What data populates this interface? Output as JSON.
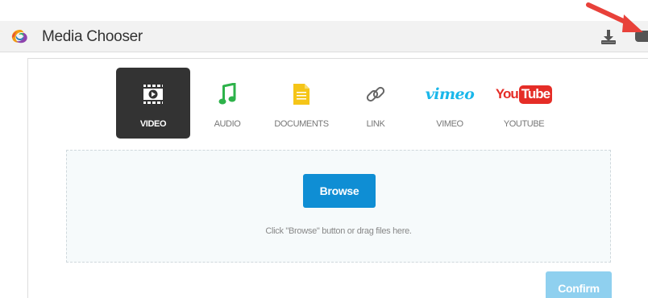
{
  "header": {
    "title": "Media Chooser"
  },
  "tabs": [
    {
      "id": "video",
      "label": "VIDEO",
      "icon": "film-icon",
      "active": true
    },
    {
      "id": "audio",
      "label": "AUDIO",
      "icon": "music-note-icon",
      "active": false
    },
    {
      "id": "documents",
      "label": "DOCUMENTS",
      "icon": "document-icon",
      "active": false
    },
    {
      "id": "link",
      "label": "LINK",
      "icon": "link-icon",
      "active": false
    },
    {
      "id": "vimeo",
      "label": "VIMEO",
      "icon": "vimeo-logo",
      "active": false,
      "logo_text": "vimeo"
    },
    {
      "id": "youtube",
      "label": "YOUTUBE",
      "icon": "youtube-logo",
      "active": false,
      "logo_you": "You",
      "logo_tube": "Tube"
    }
  ],
  "dropzone": {
    "browse_label": "Browse",
    "hint": "Click \"Browse\" button or drag files here."
  },
  "footer": {
    "confirm_label": "Confirm"
  },
  "colors": {
    "header_bg": "#f2f2f2",
    "active_tab_bg": "#333333",
    "browse_bg": "#0f8ed4",
    "confirm_bg": "#8fd0ef",
    "audio_green": "#2db24a",
    "documents_yellow": "#f5c518",
    "vimeo_blue": "#1ab7ea",
    "youtube_red": "#e52d27",
    "annotation_arrow": "#e8413a"
  }
}
